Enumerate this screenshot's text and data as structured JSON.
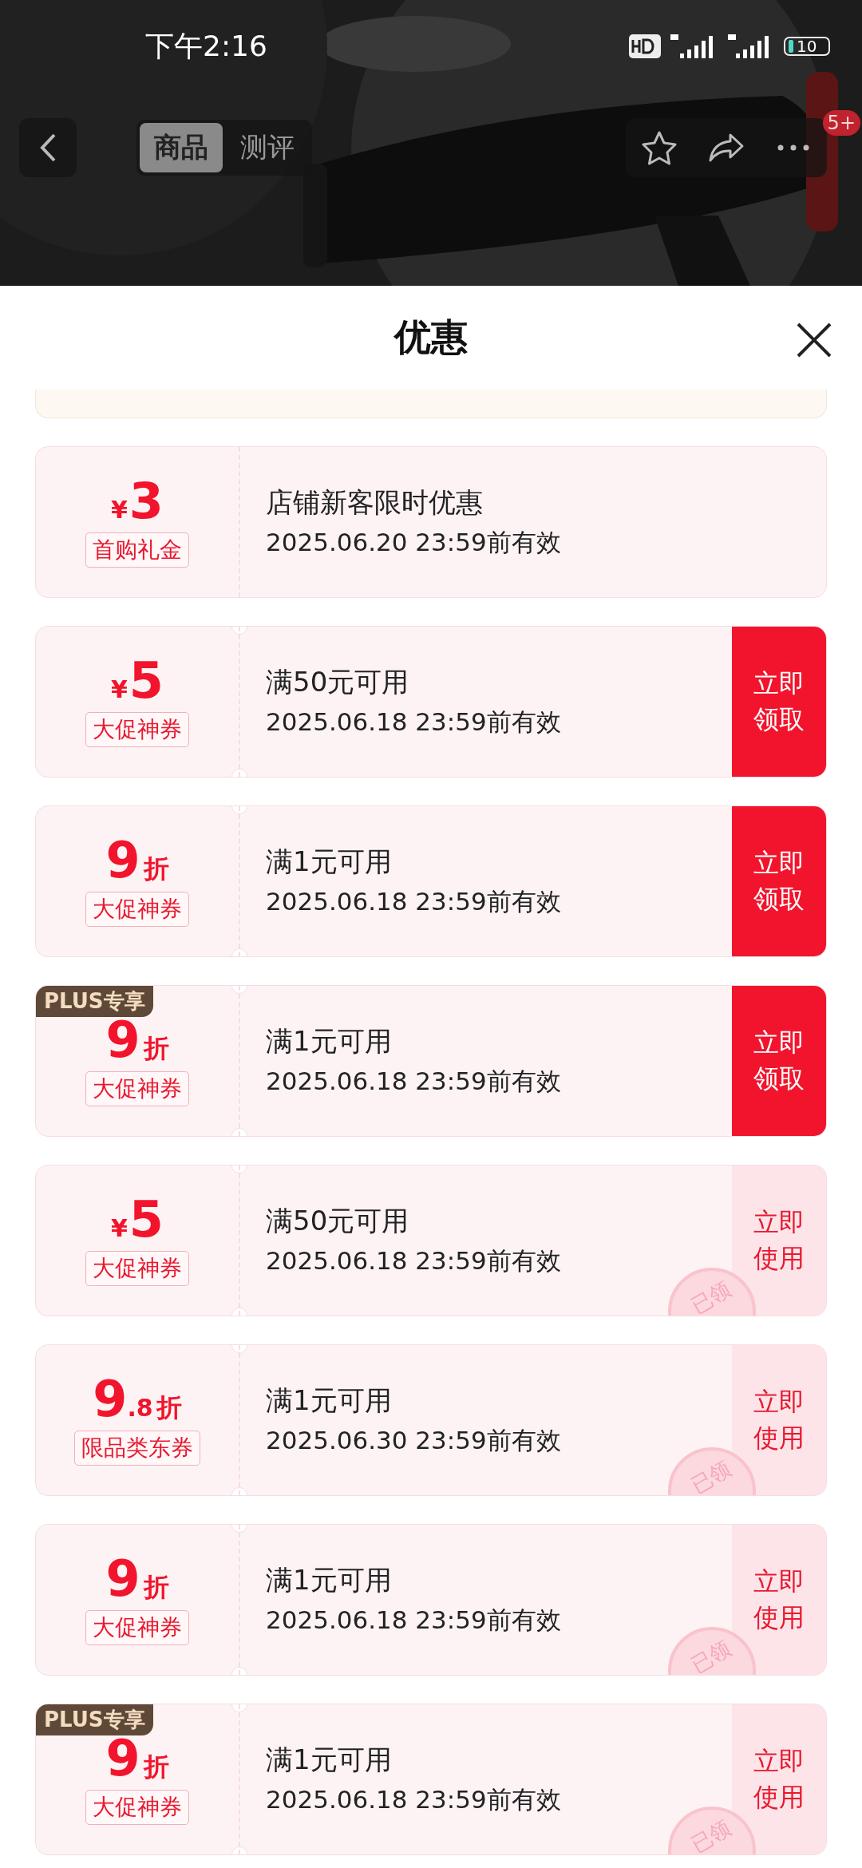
{
  "status_bar": {
    "time": "下午2:16",
    "battery": "10"
  },
  "nav": {
    "tabs": [
      {
        "label": "商品",
        "selected": true
      },
      {
        "label": "测评",
        "selected": false
      }
    ],
    "badge": "5+"
  },
  "sheet": {
    "title": "优惠"
  },
  "coupons": [
    {
      "kind": "cash",
      "currency": "¥",
      "value": "3",
      "tag": "首购礼金",
      "title": "店铺新客限时优惠",
      "validity": "2025.06.20 23:59前有效",
      "perforated": false
    },
    {
      "kind": "cash",
      "currency": "¥",
      "value": "5",
      "tag": "大促神券",
      "title": "满50元可用",
      "validity": "2025.06.18 23:59前有效",
      "perforated": true,
      "button": "立即领取",
      "claimed": false
    },
    {
      "kind": "discount",
      "value": "9",
      "unit": "折",
      "tag": "大促神券",
      "title": "满1元可用",
      "validity": "2025.06.18 23:59前有效",
      "perforated": true,
      "button": "立即领取",
      "claimed": false
    },
    {
      "kind": "discount",
      "value": "9",
      "unit": "折",
      "tag": "大促神券",
      "badge": "PLUS专享",
      "title": "满1元可用",
      "validity": "2025.06.18 23:59前有效",
      "perforated": true,
      "button": "立即领取",
      "claimed": false
    },
    {
      "kind": "cash",
      "currency": "¥",
      "value": "5",
      "tag": "大促神券",
      "title": "满50元可用",
      "validity": "2025.06.18 23:59前有效",
      "perforated": true,
      "button": "立即使用",
      "claimed": true,
      "stamp": "已领"
    },
    {
      "kind": "discount",
      "value": "9",
      "decimal": ".8",
      "unit": "折",
      "tag": "限品类东券",
      "title": "满1元可用",
      "validity": "2025.06.30 23:59前有效",
      "perforated": true,
      "button": "立即使用",
      "claimed": true,
      "stamp": "已领"
    },
    {
      "kind": "discount",
      "value": "9",
      "unit": "折",
      "tag": "大促神券",
      "title": "满1元可用",
      "validity": "2025.06.18 23:59前有效",
      "perforated": true,
      "button": "立即使用",
      "claimed": true,
      "stamp": "已领"
    },
    {
      "kind": "discount",
      "value": "9",
      "unit": "折",
      "tag": "大促神券",
      "badge": "PLUS专享",
      "title": "满1元可用",
      "validity": "2025.06.18 23:59前有效",
      "perforated": true,
      "button": "立即使用",
      "claimed": true,
      "stamp": "已领"
    }
  ]
}
